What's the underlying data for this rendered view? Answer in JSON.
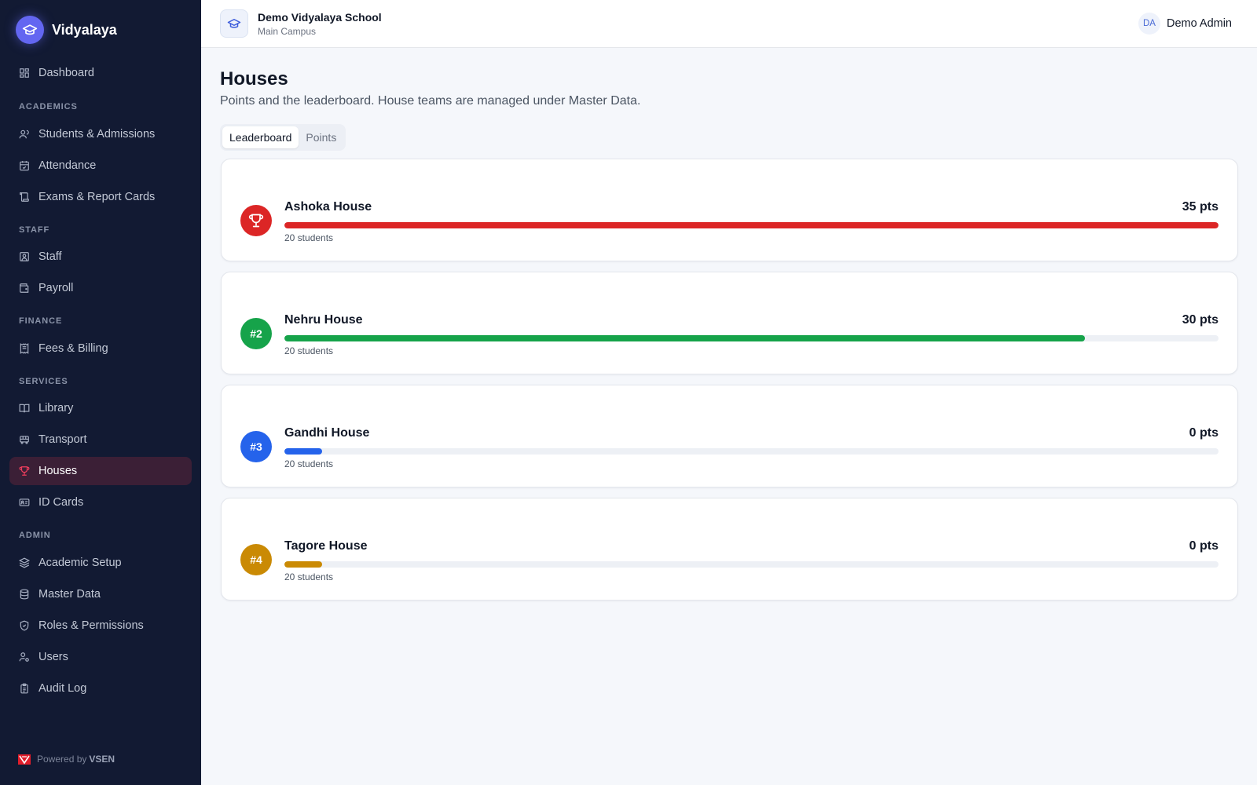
{
  "brand": {
    "name": "Vidyalaya"
  },
  "sidebar": {
    "dashboard": "Dashboard",
    "sections": {
      "academics": "ACADEMICS",
      "staff": "STAFF",
      "finance": "FINANCE",
      "services": "SERVICES",
      "admin": "ADMIN"
    },
    "items": {
      "students": "Students & Admissions",
      "attendance": "Attendance",
      "exams": "Exams & Report Cards",
      "staff": "Staff",
      "payroll": "Payroll",
      "fees": "Fees & Billing",
      "library": "Library",
      "transport": "Transport",
      "houses": "Houses",
      "idcards": "ID Cards",
      "academic_setup": "Academic Setup",
      "master_data": "Master Data",
      "roles": "Roles & Permissions",
      "users": "Users",
      "audit": "Audit Log"
    },
    "active_item": "houses",
    "footer": {
      "prefix": "Powered by",
      "brand": "VSEN"
    }
  },
  "topbar": {
    "school_name": "Demo Vidyalaya School",
    "campus": "Main Campus",
    "user_initials": "DA",
    "user_name": "Demo Admin"
  },
  "page": {
    "title": "Houses",
    "subtitle": "Points and the leaderboard. House teams are managed under Master Data.",
    "tabs": [
      "Leaderboard",
      "Points"
    ],
    "active_tab": "Leaderboard"
  },
  "leaderboard": [
    {
      "rank": "#1",
      "icon": "trophy-icon",
      "name": "Ashoka House",
      "points": "35 pts",
      "students": "20 students",
      "fill_fraction": 1.0,
      "color": "#dc2626"
    },
    {
      "rank": "#2",
      "name": "Nehru House",
      "points": "30 pts",
      "students": "20 students",
      "fill_fraction": 0.857,
      "color": "#16a34a"
    },
    {
      "rank": "#3",
      "name": "Gandhi House",
      "points": "0 pts",
      "students": "20 students",
      "fill_fraction": 0.04,
      "color": "#2563eb"
    },
    {
      "rank": "#4",
      "name": "Tagore House",
      "points": "0 pts",
      "students": "20 students",
      "fill_fraction": 0.04,
      "color": "#ca8a04"
    }
  ],
  "colors": {
    "sidebar_bg": "#121a33",
    "active_item_bg": "#3b1f36",
    "active_icon": "#f43f5e",
    "brand_accent": "#6366f1"
  }
}
